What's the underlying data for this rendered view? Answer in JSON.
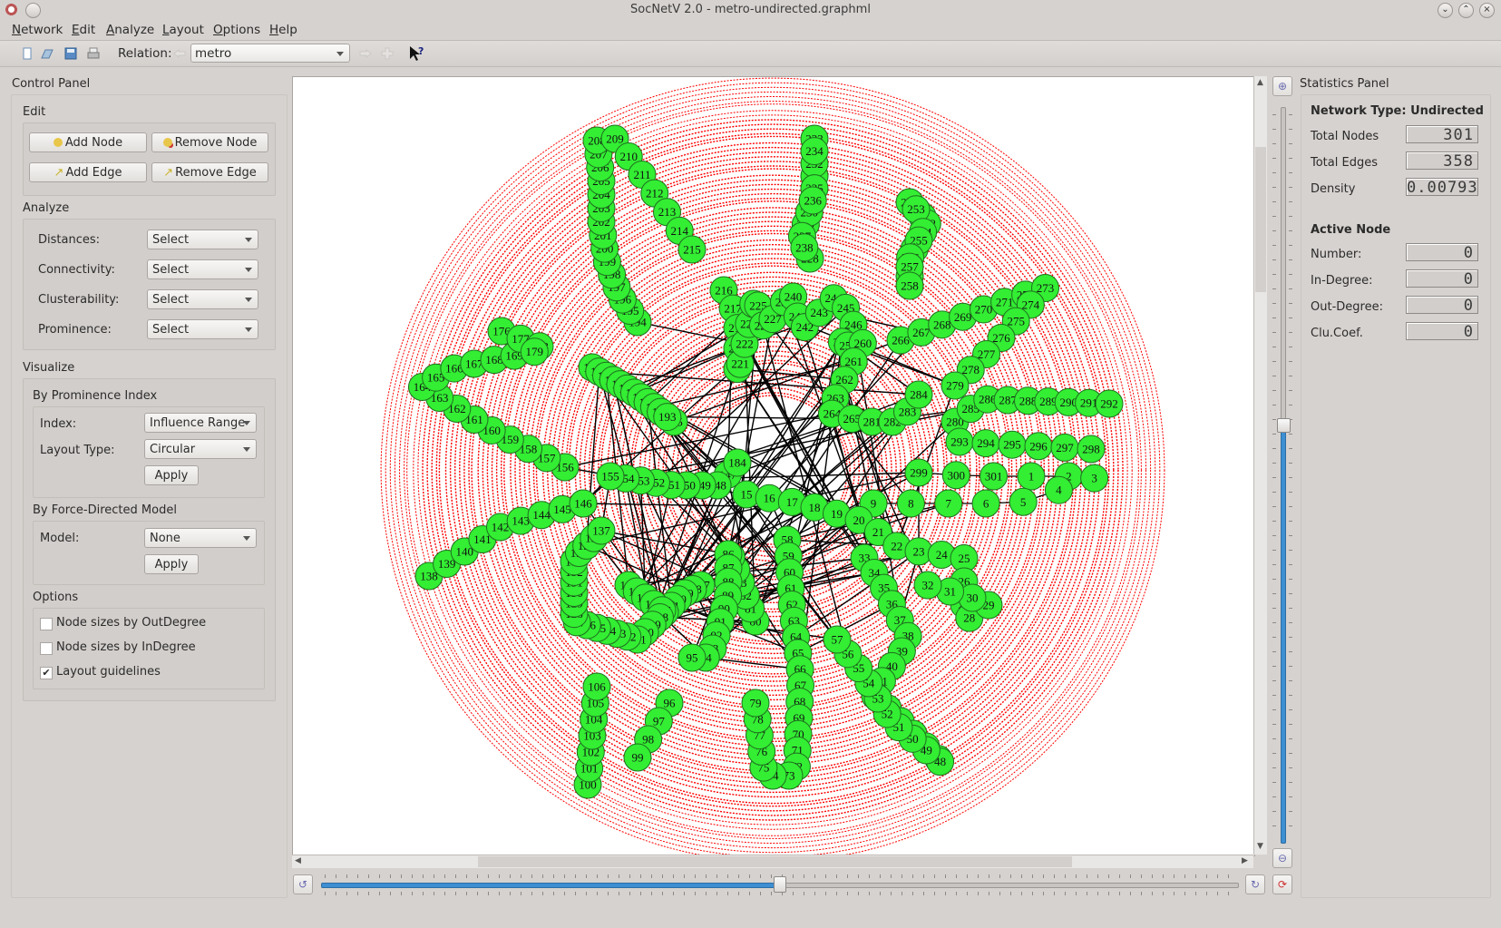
{
  "window": {
    "title": "SocNetV 2.0 - metro-undirected.graphml",
    "controls": [
      "minimize",
      "maximize",
      "close"
    ]
  },
  "menubar": {
    "items": [
      {
        "label": "Network",
        "accel": "N"
      },
      {
        "label": "Edit",
        "accel": "E"
      },
      {
        "label": "Analyze",
        "accel": "A"
      },
      {
        "label": "Layout",
        "accel": "L"
      },
      {
        "label": "Options",
        "accel": "O"
      },
      {
        "label": "Help",
        "accel": "H"
      }
    ]
  },
  "toolbar": {
    "icons": [
      "new-file-icon",
      "open-folder-icon",
      "save-icon",
      "print-icon"
    ],
    "relation_label": "Relation:",
    "relation_value": "metro",
    "prev_relation_icon": "arrow-left-icon",
    "next_relation_icon": "arrow-right-icon",
    "add_relation_icon": "plus-icon",
    "whats_this_icon": "whats-this-icon"
  },
  "control_panel": {
    "title": "Control Panel",
    "edit": {
      "title": "Edit",
      "add_node": "Add Node",
      "remove_node": "Remove Node",
      "add_edge": "Add Edge",
      "remove_edge": "Remove Edge"
    },
    "analyze": {
      "title": "Analyze",
      "rows": [
        {
          "label": "Distances:",
          "value": "Select"
        },
        {
          "label": "Connectivity:",
          "value": "Select"
        },
        {
          "label": "Clusterability:",
          "value": "Select"
        },
        {
          "label": "Prominence:",
          "value": "Select"
        }
      ]
    },
    "visualize": {
      "title": "Visualize",
      "prominence": {
        "title": "By Prominence Index",
        "index_label": "Index:",
        "index_value": "Influence Range",
        "layout_label": "Layout Type:",
        "layout_value": "Circular",
        "apply": "Apply"
      },
      "force": {
        "title": "By Force-Directed Model",
        "model_label": "Model:",
        "model_value": "None",
        "apply": "Apply"
      }
    },
    "options": {
      "title": "Options",
      "items": [
        {
          "label": "Node sizes by OutDegree",
          "checked": false
        },
        {
          "label": "Node sizes by InDegree",
          "checked": false
        },
        {
          "label": "Layout guidelines",
          "checked": true
        }
      ]
    }
  },
  "statistics_panel": {
    "title": "Statistics Panel",
    "network_type": "Network Type: Undirected",
    "total_nodes_label": "Total Nodes",
    "total_nodes": "301",
    "total_edges_label": "Total Edges",
    "total_edges": "358",
    "density_label": "Density",
    "density": "0.00793",
    "active_node_title": "Active Node",
    "number_label": "Number:",
    "number": "0",
    "indegree_label": "In-Degree:",
    "indegree": "0",
    "outdegree_label": "Out-Degree:",
    "outdegree": "0",
    "clucoef_label": "Clu.Coef.",
    "clucoef": "0"
  },
  "graph": {
    "node_color": "#33ee33",
    "node_border": "#1f6e1f",
    "guideline_color": "#ff0000",
    "edge_color": "#000000",
    "node_count": 301,
    "layout": "Circular by Influence Range"
  },
  "sliders": {
    "zoom_level": 0.5,
    "rotation_level": 0.5
  },
  "icons": {
    "zoom_in": "zoom-in-icon",
    "zoom_out": "zoom-out-icon",
    "rotate_left": "rotate-left-icon",
    "rotate_right": "rotate-right-icon",
    "reset": "reset-icon"
  }
}
